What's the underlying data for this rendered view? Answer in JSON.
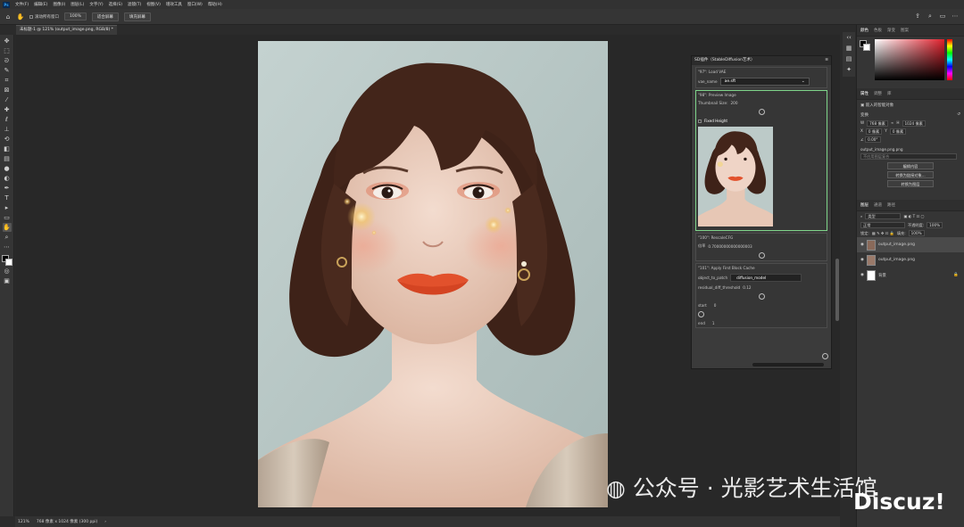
{
  "menu": {
    "app_icon": "Ps",
    "items": [
      "文件(F)",
      "编辑(E)",
      "图像(I)",
      "图层(L)",
      "文字(Y)",
      "选择(S)",
      "滤镜(T)",
      "视图(V)",
      "增效工具",
      "窗口(W)",
      "帮助(H)"
    ]
  },
  "options": {
    "scroll_all_windows": "滚动所有窗口",
    "zoom_value": "100%",
    "fit_screen": "适合屏幕",
    "fill_screen": "填充屏幕"
  },
  "document": {
    "tab_title": "未标题-1 @ 121% (output_image.png, RGB/8) *"
  },
  "status": {
    "zoom": "121%",
    "dimensions": "768 像素 x 1024 像素 (300 ppi)"
  },
  "sd_panel": {
    "title": "SD插件（StableDiffusion艺术）",
    "vae_node": "\"97\": Load VAE",
    "vae_label": "vae_name",
    "vae_value": "ae.sft",
    "preview_node": "\"98\": Preview Image",
    "thumbnail_label": "Thumbnail Size:",
    "thumbnail_value": "200",
    "fixed_height": "Fixed Height",
    "rescale_node": "\"100\": RescaleCFG",
    "multiplier_label": "倍率",
    "multiplier_value": "0.70000000000000003",
    "cache_node": "\"101\": Apply First Block Cache",
    "object_label": "object_to_patch",
    "object_value": "diffusion_model",
    "residual_label": "residual_diff_threshold",
    "residual_value": "0.12",
    "start_label": "start",
    "start_value": "0",
    "end_label": "end",
    "end_value": "1"
  },
  "panels": {
    "color_tabs": [
      "颜色",
      "色板",
      "渐变",
      "图案"
    ],
    "prop_tabs": [
      "属性",
      "调整",
      "库"
    ],
    "smart_object": "嵌入的智能对象",
    "transform": "变换",
    "w_label": "W",
    "w_value": "768 像素",
    "h_label": "H",
    "h_value": "1024 像素",
    "x_label": "X",
    "x_value": "0 像素",
    "y_label": "Y",
    "y_value": "0 像素",
    "angle_value": "0.00°",
    "filename": "output_image.png.png",
    "no_comp": "不应用图层复合",
    "edit_content": "编辑内容",
    "convert_linked": "转换为链接对象...",
    "convert_layers": "转换为图层",
    "layer_tabs": [
      "图层",
      "通道",
      "路径"
    ],
    "kind": "类型",
    "blend_mode": "正常",
    "opacity_label": "不透明度:",
    "opacity_value": "100%",
    "lock_label": "锁定:",
    "fill_label": "填充:",
    "fill_value": "100%",
    "layers": [
      "output_image.png",
      "output_image.png",
      "背景"
    ]
  },
  "watermark": {
    "wechat": "公众号 · 光影艺术生活馆",
    "discuz": "Discuz!"
  },
  "colors": {
    "accent_green": "#7fd58a",
    "gradient_red": "#e0202c",
    "lips": "#e2512c"
  }
}
